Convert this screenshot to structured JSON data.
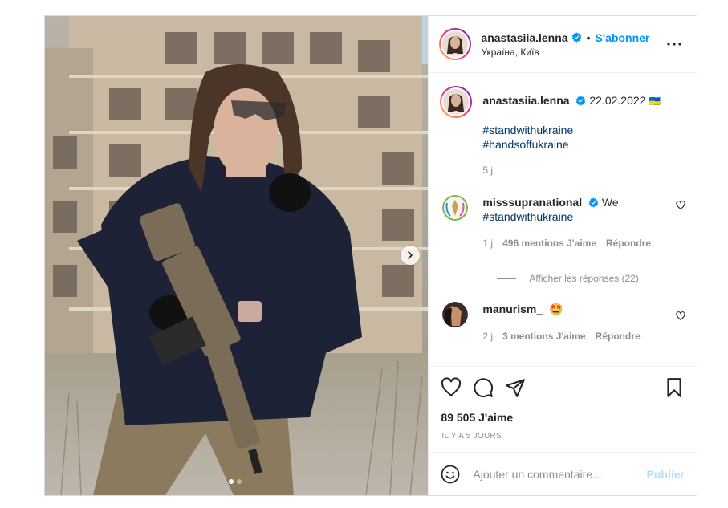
{
  "post": {
    "username": "anastasiia.lenna",
    "follow_label": "S'abonner",
    "separator": "•",
    "location": "Україна, Київ",
    "caption_date": "22.02.2022",
    "caption_flag": "🇺🇦",
    "hashtags": [
      "#standwithukraine",
      "#handsoffukraine"
    ],
    "caption_age": "5 j",
    "carousel_index": 1,
    "carousel_total": 2
  },
  "comments": [
    {
      "username": "misssupranational",
      "text": "We",
      "hashtag": "#standwithukraine",
      "age": "1 j",
      "likes": "496 mentions J'aime",
      "reply": "Répondre",
      "view_replies": "Afficher les réponses (22)"
    },
    {
      "username": "manurism_",
      "emoji": "🤩",
      "age": "2 j",
      "likes": "3 mentions J'aime",
      "reply": "Répondre"
    }
  ],
  "stats": {
    "likes": "89 505 J'aime",
    "time_ago": "IL Y A 5 JOURS"
  },
  "composer": {
    "placeholder": "Ajouter un commentaire...",
    "publish_label": "Publier"
  },
  "colors": {
    "accent": "#0095f6",
    "hashtag": "#00376b",
    "muted": "#8e8e8e",
    "publish_disabled": "#b2dffc"
  }
}
